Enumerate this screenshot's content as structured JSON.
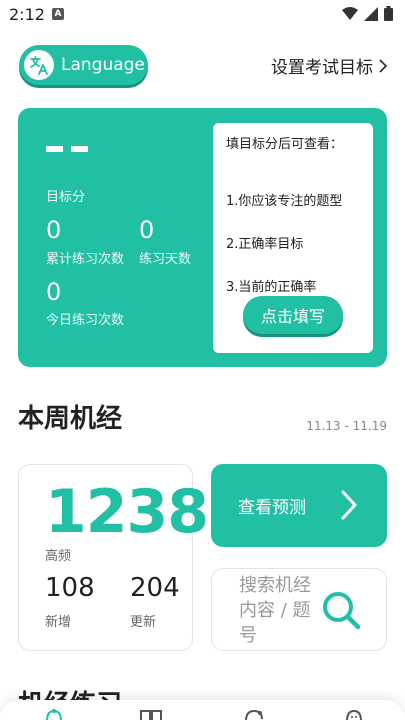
{
  "status_bar": {
    "time": "2:12",
    "notif_letter": "A"
  },
  "header": {
    "language_label": "Language",
    "target_link": "设置考试目标"
  },
  "hero": {
    "target_score_value": "",
    "target_score_label": "目标分",
    "total_practice_value": "0",
    "total_practice_label": "累计练习次数",
    "practice_days_value": "0",
    "practice_days_label": "练习天数",
    "today_practice_value": "0",
    "today_practice_label": "今日练习次数",
    "card": {
      "heading": "填目标分后可查看：",
      "line1": "1.你应该专注的题型",
      "line2": "2.正确率目标",
      "line3": "3.当前的正确率",
      "button": "点击填写"
    }
  },
  "weekly": {
    "title": "本周机经",
    "date_range": "11.13 - 11.19",
    "high_freq_value": "1238",
    "high_freq_label": "高频",
    "new_value": "108",
    "new_label": "新增",
    "updated_value": "204",
    "updated_label": "更新",
    "predict_label": "查看预测",
    "search_placeholder": "搜索机经内容 / 题号"
  },
  "next_section": {
    "title": "机经练习"
  },
  "colors": {
    "accent": "#21c0a5",
    "accent_dark": "#16927d"
  }
}
